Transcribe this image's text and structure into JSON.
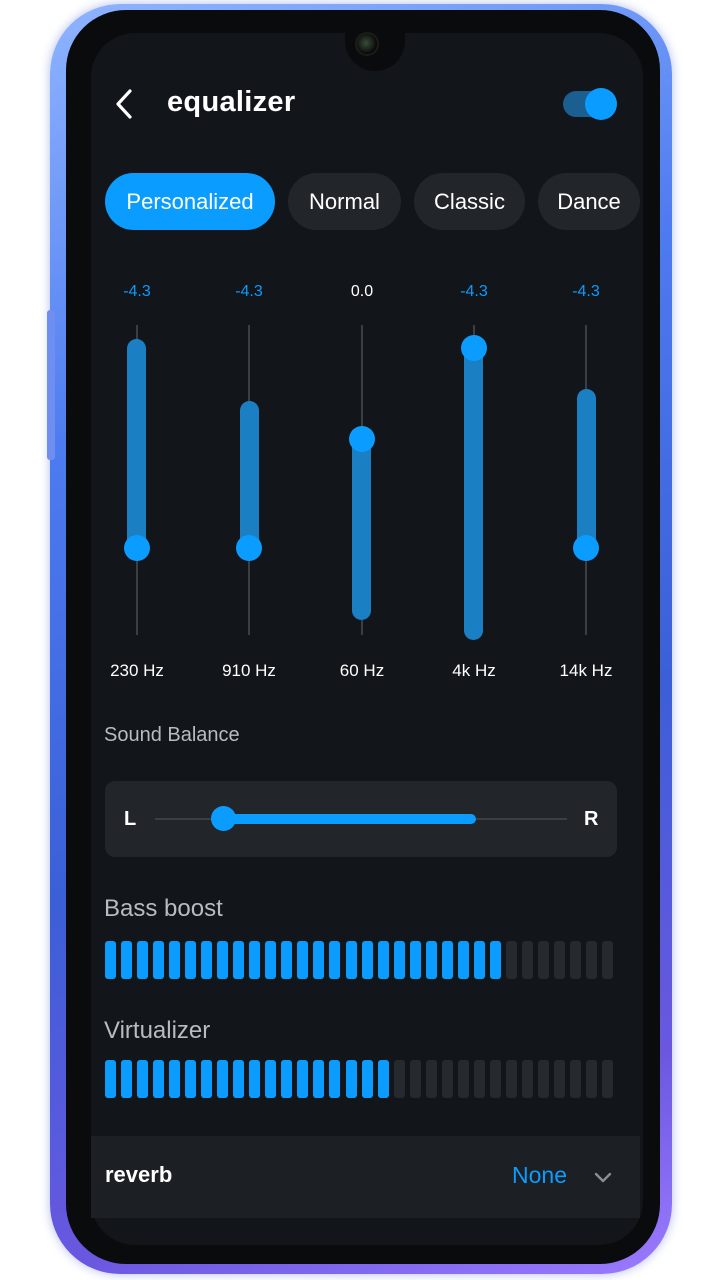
{
  "header": {
    "title": "equalizer",
    "back_icon": "chevron-left-icon",
    "enabled": true
  },
  "presets": [
    {
      "label": "Personalized",
      "active": true
    },
    {
      "label": "Normal",
      "active": false
    },
    {
      "label": "Classic",
      "active": false
    },
    {
      "label": "Dance",
      "active": false
    }
  ],
  "equalizer": {
    "bands": [
      {
        "value": "-4.3",
        "label": "230 Hz"
      },
      {
        "value": "-4.3",
        "label": "910 Hz"
      },
      {
        "value": "0.0",
        "label": "60 Hz"
      },
      {
        "value": "-4.3",
        "label": "4k Hz"
      },
      {
        "value": "-4.3",
        "label": "14k Hz"
      }
    ]
  },
  "sound_balance": {
    "title": "Sound Balance",
    "left_label": "L",
    "right_label": "R"
  },
  "bass_boost": {
    "title": "Bass boost",
    "level": 25,
    "segments": 32
  },
  "virtualizer": {
    "title": "Virtualizer",
    "level": 18,
    "segments": 32
  },
  "reverb": {
    "label": "reverb",
    "value": "None",
    "icon": "chevron-down-icon"
  },
  "colors": {
    "accent": "#0a9cff",
    "background": "#121519",
    "card": "#22262b"
  }
}
